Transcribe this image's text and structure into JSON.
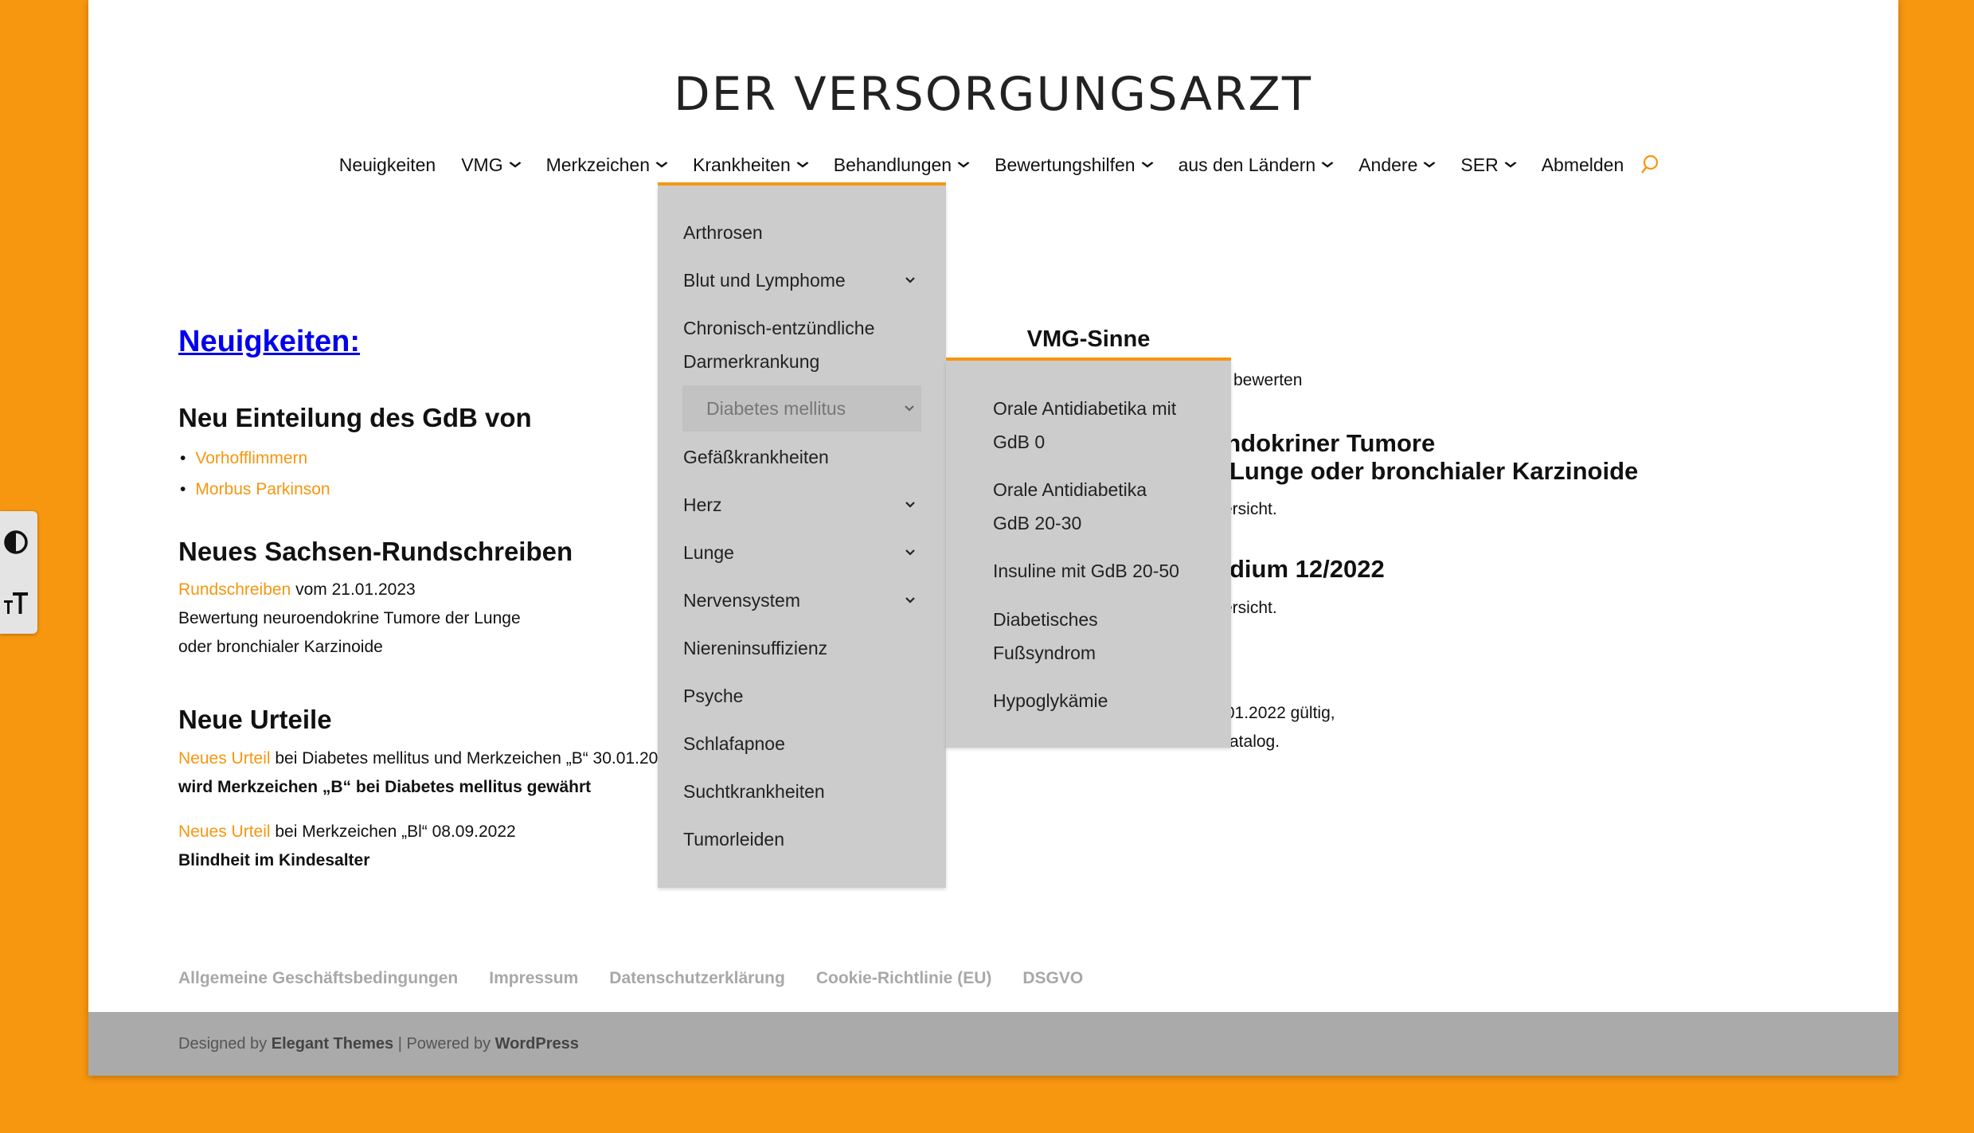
{
  "site": {
    "logo_text": "DER VERSORGUNGSARZT"
  },
  "nav": {
    "items": [
      {
        "label": "Neuigkeiten",
        "has_dropdown": false
      },
      {
        "label": "VMG",
        "has_dropdown": true
      },
      {
        "label": "Merkzeichen",
        "has_dropdown": true
      },
      {
        "label": "Krankheiten",
        "has_dropdown": true
      },
      {
        "label": "Behandlungen",
        "has_dropdown": true
      },
      {
        "label": "Bewertungshilfen",
        "has_dropdown": true
      },
      {
        "label": "aus den Ländern",
        "has_dropdown": true
      },
      {
        "label": "Andere",
        "has_dropdown": true
      },
      {
        "label": "SER",
        "has_dropdown": true
      },
      {
        "label": "Abmelden",
        "has_dropdown": false
      }
    ],
    "search_icon": "search-icon",
    "accent_color": "#F7960F"
  },
  "krankheiten_menu": {
    "items": [
      {
        "label": "Arthrosen"
      },
      {
        "label": "Blut und Lymphome"
      },
      {
        "label": "Chronisch-entzündliche"
      },
      {
        "label": "Darmerkrankung"
      },
      {
        "label": "Diabetes mellitus"
      },
      {
        "label": "Gefäßkrankheiten"
      },
      {
        "label": "Herz"
      },
      {
        "label": "Lunge"
      },
      {
        "label": "Nervensystem"
      },
      {
        "label": "Niereninsuffizienz"
      },
      {
        "label": "Psyche"
      },
      {
        "label": "Schlafapnoe"
      },
      {
        "label": "Suchtkrankheiten"
      },
      {
        "label": "Tumorleiden"
      }
    ]
  },
  "diabetes_submenu": {
    "items": [
      {
        "line1": "Orale Antidiabetika mit",
        "line2": "GdB 0"
      },
      {
        "line1": "Orale Antidiabetika",
        "line2": "GdB 20-30"
      },
      {
        "line1": "Insuline mit GdB 20-50",
        "line2": ""
      },
      {
        "line1": "Diabetisches",
        "line2": "Fußsyndrom"
      },
      {
        "line1": "Hypoglykämie",
        "line2": ""
      }
    ]
  },
  "main": {
    "news_heading": "Neuigkeiten:",
    "section1": {
      "title": "Neu Einteilung des GdB von",
      "links": [
        "Vorhofflimmern",
        "Morbus Parkinson"
      ]
    },
    "section2": {
      "title": "Neues Sachsen-Rundschreiben",
      "link": "Rundschreiben",
      "date_text": " vom 21.01.2023",
      "line2": "Bewertung neuroendokrine Tumore der Lunge",
      "line3": "oder bronchialer Karzinoide"
    },
    "section3": {
      "title": "Neue Urteile",
      "u1_link": "Neues Urteil",
      "u1_text": " bei Diabetes mellitus und Merkzeichen „B“ 30.01.20",
      "u1_bold": "wird Merkzeichen „B“ bei Diabetes mellitus gewährt",
      "u2_link": "Neues Urteil",
      "u2_text": " bei Merkzeichen „Bl“ 08.09.2022",
      "u2_bold": "Blindheit im Kindesalter"
    }
  },
  "right_column": {
    "vmg_title": "VMG-Sinne",
    "frag1": "bewerten",
    "frag2": "endokriner Tumore",
    "frag3": "Lunge oder bronchialer Karzinoide",
    "frag4": "ersicht.",
    "frag5": "dium 12/2022",
    "frag6": "ersicht.",
    "frag7": ".01.2022 gültig,",
    "frag8": "atalog."
  },
  "footer": {
    "links": [
      "Allgemeine Geschäftsbedingungen",
      "Impressum",
      "Datenschutzerklärung",
      "Cookie-Richtlinie (EU)",
      "DSGVO"
    ],
    "designed_by": "Designed by ",
    "elegant": "Elegant Themes",
    "powered_by": " | Powered by ",
    "wordpress": "WordPress"
  },
  "accessibility": {
    "contrast_icon": "contrast-icon",
    "font_size_icon": "font-size-icon"
  }
}
